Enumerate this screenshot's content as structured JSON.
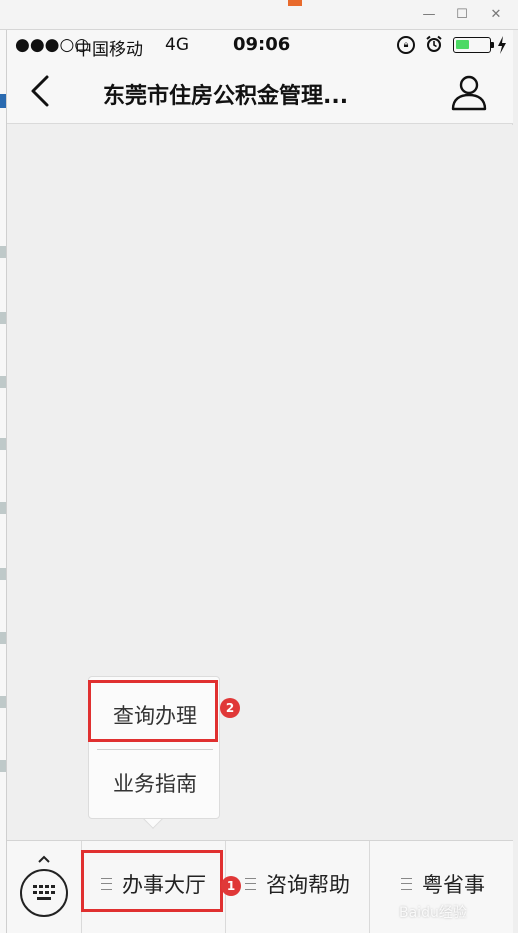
{
  "window": {
    "minimize_glyph": "—",
    "maximize_glyph": "☐",
    "close_glyph": "✕"
  },
  "status_bar": {
    "signal": "●●●○○",
    "carrier": "中国移动",
    "network": "4G",
    "time": "09:06",
    "battery_level_percent": 40,
    "icons": [
      "rotation-lock-icon",
      "alarm-icon",
      "battery-icon",
      "charging-icon"
    ]
  },
  "nav": {
    "title": "东莞市住房公积金管理...",
    "back_icon": "chevron-left-icon",
    "profile_icon": "user-icon"
  },
  "submenu": {
    "items": [
      {
        "label": "查询办理",
        "badge": "2"
      },
      {
        "label": "业务指南"
      }
    ]
  },
  "bottom_menu": {
    "keyboard_icon": "keyboard-icon",
    "tabs": [
      {
        "label": "办事大厅",
        "badge": "1"
      },
      {
        "label": "咨询帮助"
      },
      {
        "label": "粤省事"
      }
    ]
  },
  "watermark": "Baidu经验",
  "colors": {
    "highlight": "#e03030",
    "battery": "#4cd964",
    "background": "#efefef"
  }
}
